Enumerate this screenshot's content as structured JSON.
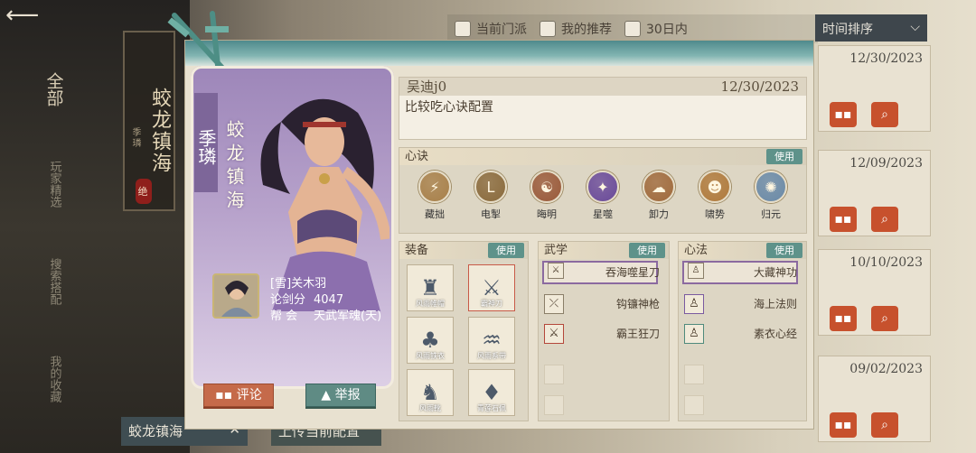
{
  "nav": {
    "back_icon": "back-arrow-icon",
    "title": "蛟龙镇海",
    "title_sub": "季璘",
    "title_seal": "绝",
    "side_items": [
      "全部",
      "玩家精选",
      "搜索搭配",
      "我的收藏"
    ]
  },
  "filters": {
    "items": [
      "当前门派",
      "我的推荐",
      "30日内"
    ],
    "sort_label": "时间排序",
    "sort_icon": "chevron-down-icon"
  },
  "cards": [
    {
      "date": "12/30/2023"
    },
    {
      "date": "12/09/2023"
    },
    {
      "date": "10/10/2023"
    },
    {
      "date": "09/02/2023"
    }
  ],
  "bottom": {
    "left_label": "蛟龙镇海",
    "mid_label": "上传当前配置"
  },
  "profile": {
    "ribbon": "季璘",
    "character_name": "蛟龙镇海",
    "player_name": "[雪]关木羽",
    "rank_label": "论剑分",
    "rank_value": "4047",
    "guild_label": "帮 会",
    "guild_value": "天武军魂(天)",
    "comment_btn": "评论",
    "report_btn": "举报"
  },
  "post": {
    "author": "吴迪j0",
    "date": "12/30/2023",
    "text": "比较吃心诀配置"
  },
  "xinjue": {
    "title": "心诀",
    "use": "使用",
    "skills": [
      {
        "name": "藏拙",
        "color": "#a8804a",
        "glyph": "⚡"
      },
      {
        "name": "电掣",
        "color": "#8a6a3c",
        "glyph": "ᒪ"
      },
      {
        "name": "晦明",
        "color": "#9a5a3a",
        "glyph": "☯"
      },
      {
        "name": "星噬",
        "color": "#6a4a9a",
        "glyph": "✦"
      },
      {
        "name": "卸力",
        "color": "#a06a3c",
        "glyph": "☁"
      },
      {
        "name": "啸势",
        "color": "#b07a3c",
        "glyph": "☻"
      },
      {
        "name": "归元",
        "color": "#6a8aa8",
        "glyph": "✺"
      }
    ]
  },
  "equip": {
    "title": "装备",
    "use": "使用",
    "items": [
      {
        "cap": "风雨帷帽",
        "glyph": "♜"
      },
      {
        "cap": "霸神刀",
        "glyph": "⚔"
      },
      {
        "cap": "风雨铁衣",
        "glyph": "♣"
      },
      {
        "cap": "风雨系带",
        "glyph": "♒"
      },
      {
        "cap": "风雨靴",
        "glyph": "♞"
      },
      {
        "cap": "青莲石佩",
        "glyph": "♦"
      }
    ]
  },
  "wuxue": {
    "title": "武学",
    "use": "使用",
    "items": [
      "吞海噬星刀",
      "钩镰神枪",
      "霸王狂刀"
    ]
  },
  "xinfa": {
    "title": "心法",
    "use": "使用",
    "items": [
      "大藏神功",
      "海上法则",
      "素衣心经"
    ]
  }
}
